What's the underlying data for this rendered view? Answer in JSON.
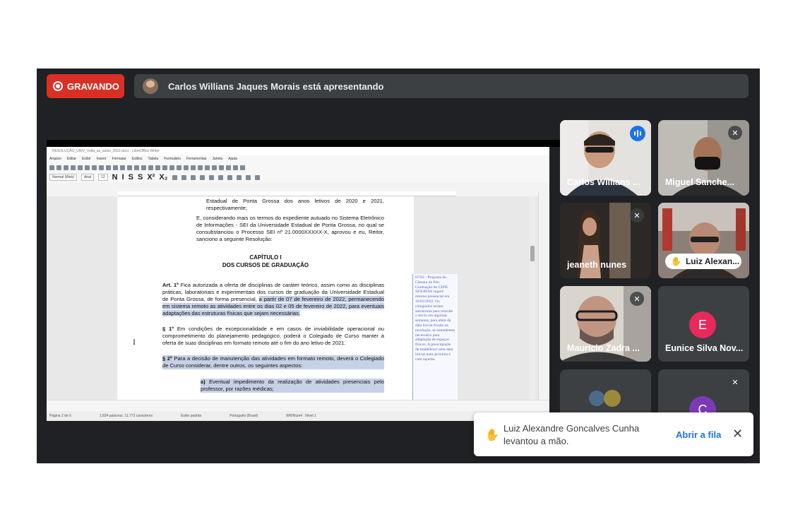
{
  "recording": {
    "label": "GRAVANDO"
  },
  "presenter": {
    "text": "Carlos Willians Jaques Morais está apresentando"
  },
  "writer": {
    "title": "RESOLUÇÃO_UNIV_Volta_as_aulas_2022.docx - LibreOffice Writer",
    "menu": [
      "Arquivo",
      "Editar",
      "Exibir",
      "Inserir",
      "Formatar",
      "Estilos",
      "Tabela",
      "Formulário",
      "Ferramentas",
      "Janela",
      "Ajuda"
    ],
    "para_style": "Normal (Web)",
    "font_name": "Arial",
    "font_size": "12",
    "doc": {
      "l1": "Estadual de Ponta Grossa dos anos letivos de 2020 e 2021, respectivamente;",
      "l2": "E, considerando mais os termos do expediente autuado no Sistema Eletrônico de Informações - SEI da Universidade Estadual de Ponta Grossa, no qual se consubstanciou o Processo SEI nº 21.0000XXXXX-X, aprovou e eu, Reitor, sanciono a seguinte Resolução:",
      "cap1": "CAPÍTULO I",
      "cap2": "DOS CURSOS DE GRADUAÇÃO",
      "art1_lead": "Art. 1º",
      "art1_a": "Fica autorizada a oferta de disciplinas de caráter teórico, assim como as disciplinas práticas, laboratoriais e experimentais dos cursos de graduação da Universidade Estadual de Ponta Grossa, de forma presencial,",
      "art1_b": "a partir de 07 de fevereiro de 2022, permanecendo em sistema remoto as atividades entre os dias 02 e 05 de fevereiro de 2022, para eventuais adaptações das estruturas físicas que sejam necessárias.",
      "p1_lead": "§ 1º",
      "p1": "Em condições de excepcionalidade e em casos de inviabilidade operacional ou comprometimento do planejamento pedagógico, poderá o Colegiado de Curso manter a oferta de suas disciplinas em formato remoto até o fim do ano letivo de 2021.",
      "p2_lead": "§ 2º",
      "p2": "Para a decisão de manutenção das atividades em formato remoto, deverá o Colegiado de Curso considerar, dentre outros, os seguintes aspectos:",
      "a_lead": "a)",
      "a": "Eventual impedimento da realização de atividades presenciais pelo professor, por razões médicas;"
    },
    "comment": "07/02 - Proposta da Câmara de Pós-Graduação do CEPE. SENATAS sugere retorno presencial em 16/02/2022. Os colegiados teriam autonomia para retardar o início em algumas semanas, para além da data inicial fixada na resolução, se entenderem necessário para adaptação de espaços físicos. A preocupação de estabelecer uma data inicial mais próxima é com aquelas",
    "status": {
      "page": "Página 2 de 6",
      "words": "1.834 palavras, 11.773 caracteres",
      "style": "Estilo padrão",
      "lang": "Português (Brasil)",
      "level": "WWNum4 : Nível 1"
    }
  },
  "participants": [
    {
      "name": "Carlos Willians ...",
      "speaking": true
    },
    {
      "name": "Miguel Sanche...",
      "muted": true
    },
    {
      "name": "jeaneth nunes",
      "muted": true
    },
    {
      "name": "Luiz Alexan...",
      "hand_raised": true
    },
    {
      "name": "Mauricio Zadra ...",
      "muted": true
    },
    {
      "name": "Eunice Silva Nov...",
      "initial": "E",
      "color": "#e8295b"
    },
    {
      "name": "",
      "muted": false
    },
    {
      "name": "",
      "initial": "C",
      "color": "#7b3ab7",
      "muted": true
    }
  ],
  "toast": {
    "message": "Luiz Alexandre Goncalves Cunha levantou a mão.",
    "action": "Abrir a fila"
  },
  "colors": {
    "meet_bg": "#202124",
    "tile_bg": "#3c4043",
    "rec_red": "#d93025",
    "link_blue": "#1a73e8"
  }
}
